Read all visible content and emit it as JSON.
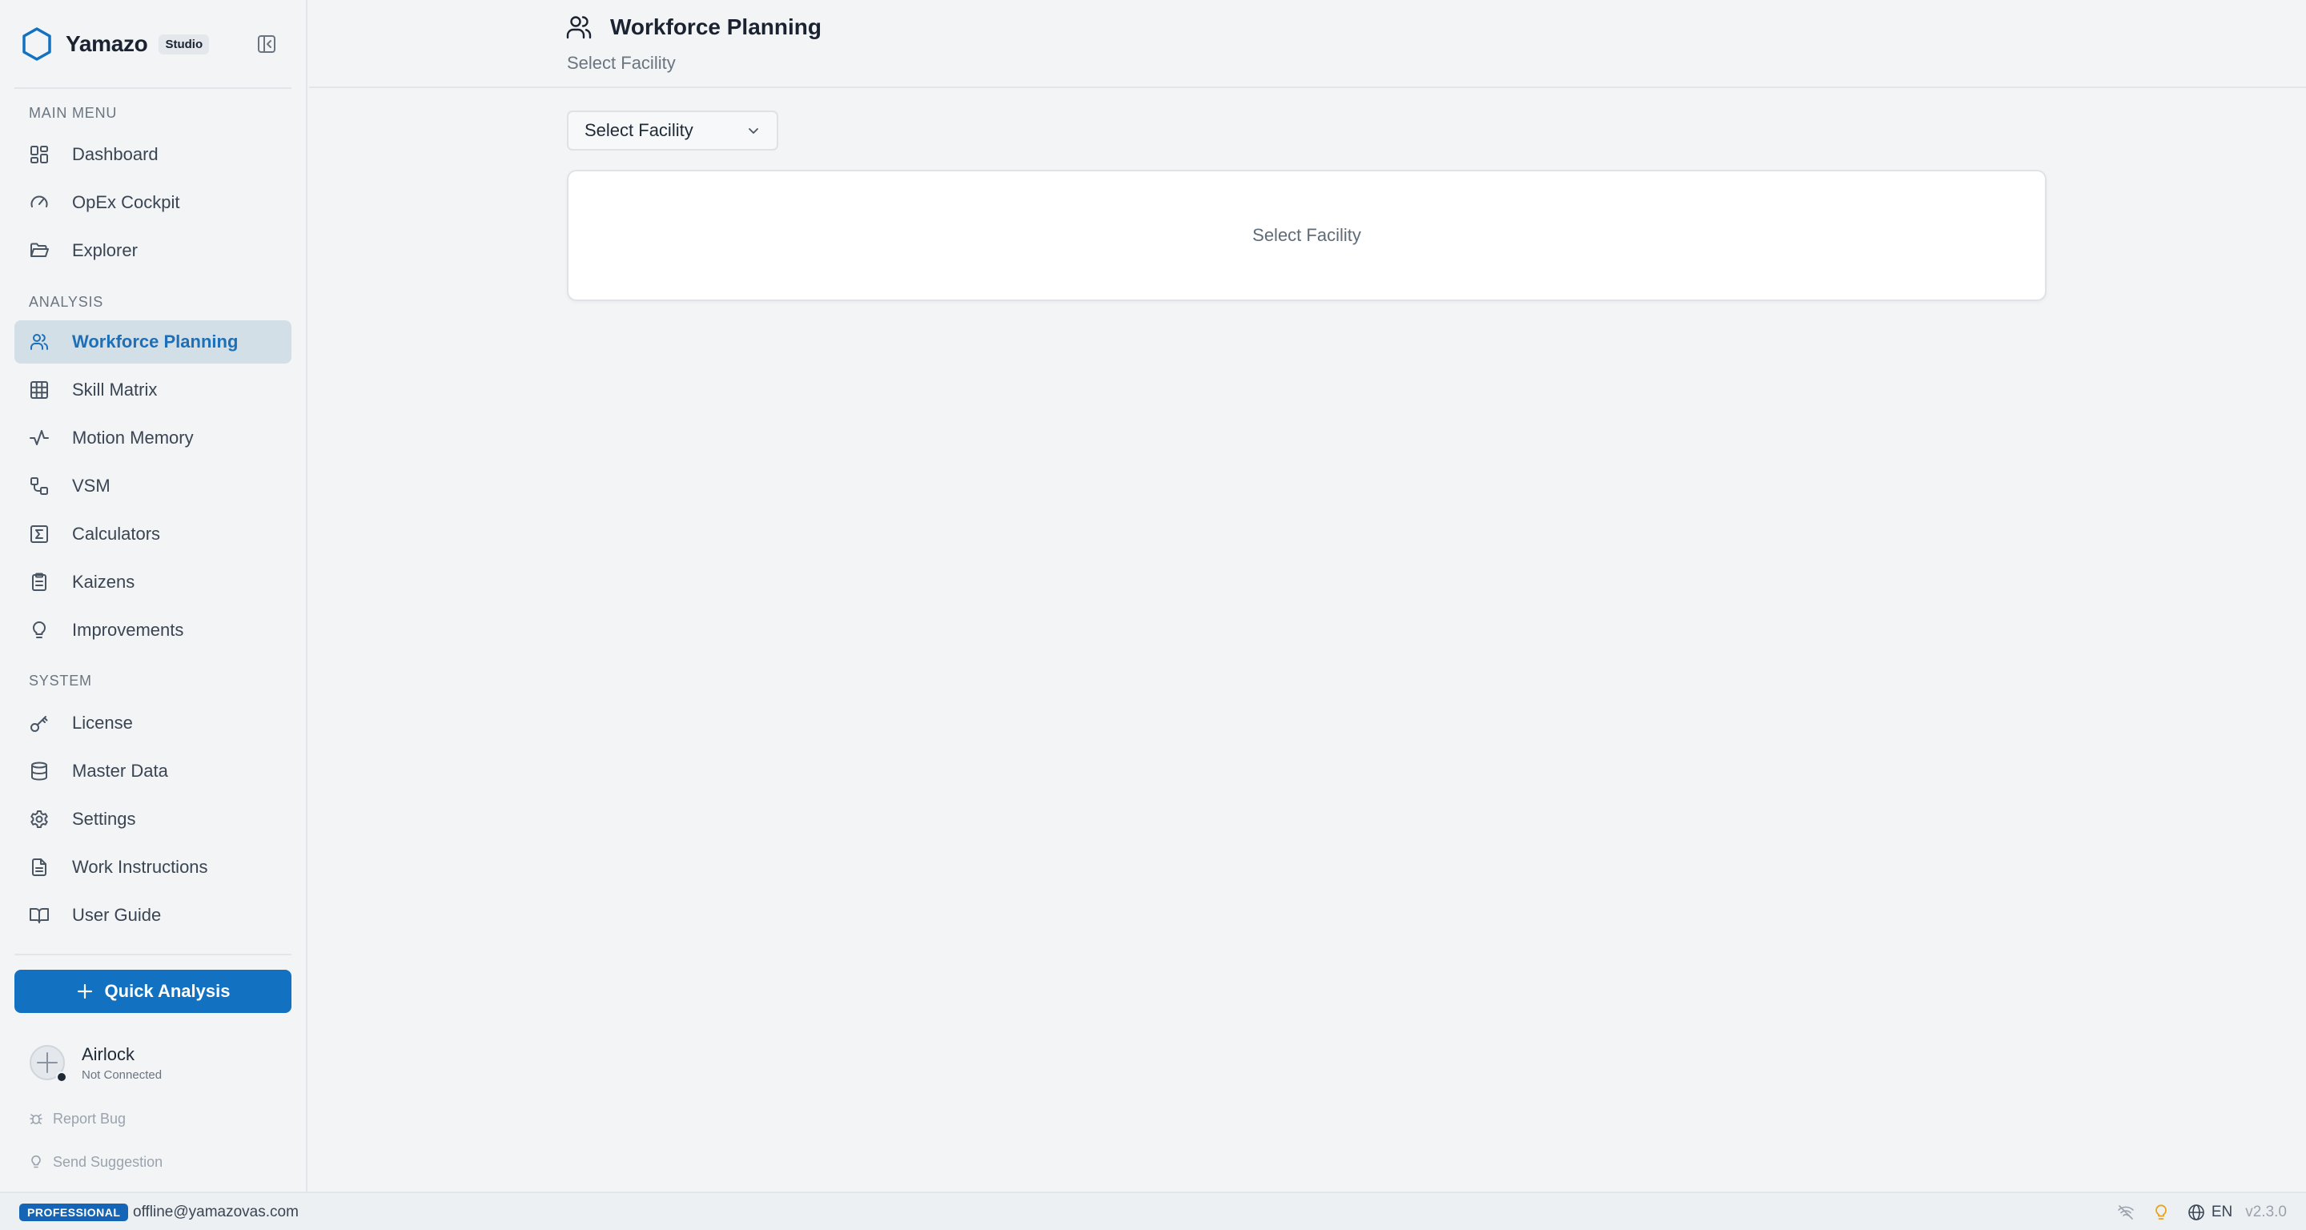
{
  "brand": {
    "name": "Yamazo",
    "badge": "Studio"
  },
  "sidebar": {
    "sections": {
      "main": "MAIN MENU",
      "analysis": "ANALYSIS",
      "system": "SYSTEM"
    },
    "items": [
      {
        "label": "Dashboard",
        "icon": "dashboard-icon"
      },
      {
        "label": "OpEx Cockpit",
        "icon": "gauge-icon"
      },
      {
        "label": "Explorer",
        "icon": "folder-icon"
      },
      {
        "label": "Workforce Planning",
        "icon": "users-icon",
        "active": true
      },
      {
        "label": "Skill Matrix",
        "icon": "grid-icon"
      },
      {
        "label": "Motion Memory",
        "icon": "activity-icon"
      },
      {
        "label": "VSM",
        "icon": "workflow-icon"
      },
      {
        "label": "Calculators",
        "icon": "sigma-icon"
      },
      {
        "label": "Kaizens",
        "icon": "clipboard-icon"
      },
      {
        "label": "Improvements",
        "icon": "lightbulb-icon"
      },
      {
        "label": "License",
        "icon": "key-icon"
      },
      {
        "label": "Master Data",
        "icon": "database-icon"
      },
      {
        "label": "Settings",
        "icon": "gear-icon"
      },
      {
        "label": "Work Instructions",
        "icon": "file-icon"
      },
      {
        "label": "User Guide",
        "icon": "book-icon"
      }
    ],
    "quick_analysis": "Quick Analysis",
    "airlock": {
      "title": "Airlock",
      "status": "Not Connected"
    },
    "report_bug": "Report Bug",
    "send_suggestion": "Send Suggestion"
  },
  "header": {
    "title": "Workforce Planning",
    "subtitle": "Select Facility"
  },
  "main": {
    "facility_select": "Select Facility",
    "card_message": "Select Facility"
  },
  "footer": {
    "tier": "PROFESSIONAL",
    "email": "offline@yamazovas.com",
    "language": "EN",
    "version": "v2.3.0"
  },
  "colors": {
    "accent": "#1371c1",
    "active_bg": "#d3dfe7",
    "active_text": "#1d6fb8",
    "bulb": "#e8a317"
  }
}
